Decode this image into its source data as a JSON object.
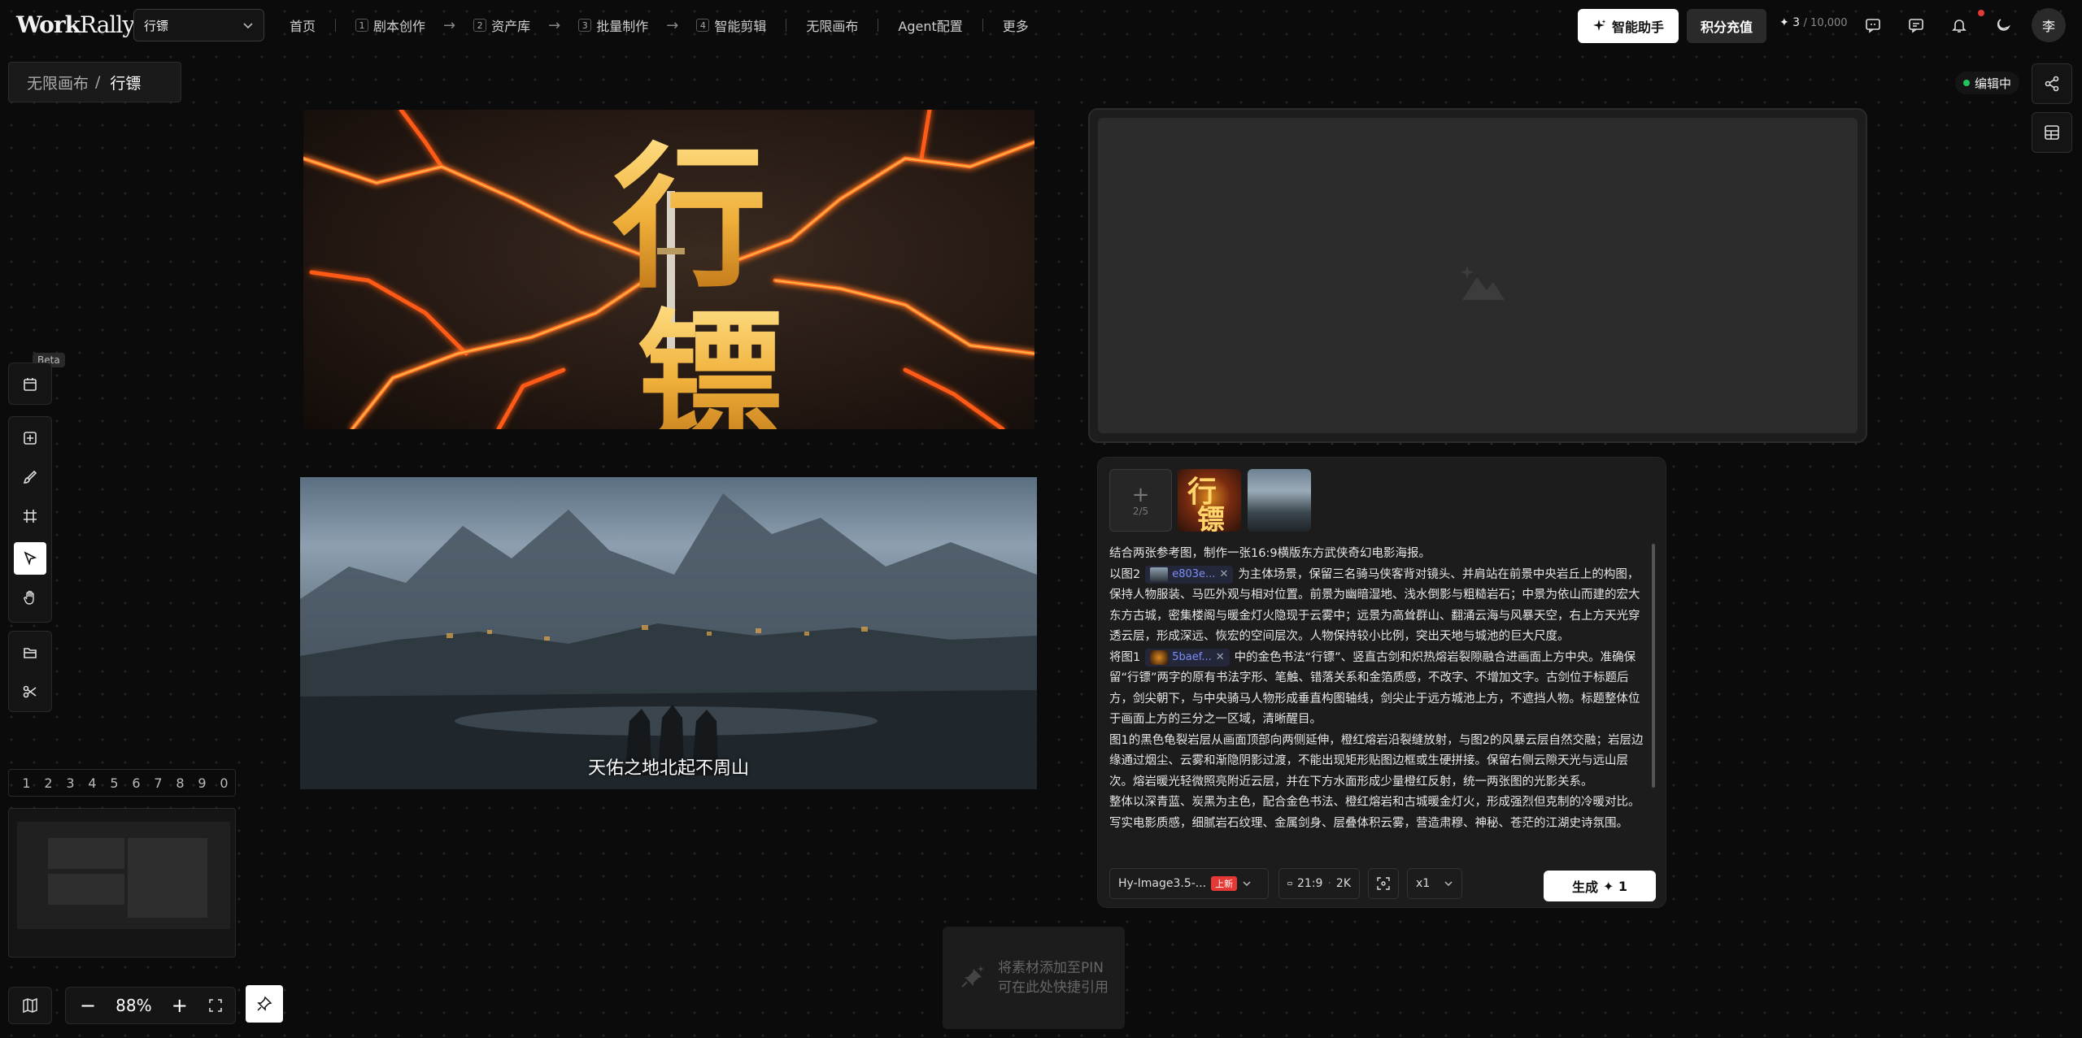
{
  "app": {
    "logo_part1": "Work",
    "logo_part2": "Rally"
  },
  "project_select": {
    "value": "行镖"
  },
  "nav": {
    "home": "首页",
    "steps": [
      {
        "num": "1",
        "label": "剧本创作"
      },
      {
        "num": "2",
        "label": "资产库"
      },
      {
        "num": "3",
        "label": "批量制作"
      },
      {
        "num": "4",
        "label": "智能剪辑"
      }
    ],
    "canvas": "无限画布",
    "agent": "Agent配置",
    "more": "更多"
  },
  "header": {
    "assistant_label": "智能助手",
    "recharge_label": "积分充值",
    "credits_used": "✦ 3",
    "credits_max": "/ 10,000",
    "avatar": "李"
  },
  "breadcrumb": {
    "parent": "无限画布",
    "sep": "/",
    "current": "行镖"
  },
  "edit_status": "编辑中",
  "beta_label": "Beta",
  "digits": [
    "1",
    "2",
    "3",
    "4",
    "5",
    "6",
    "7",
    "8",
    "9",
    "0"
  ],
  "zoom": {
    "minus": "−",
    "value": "88%",
    "plus": "+"
  },
  "poster1": {
    "title_chars": [
      "行",
      "镖"
    ]
  },
  "poster2": {
    "subtitle": "天佑之地北起不周山"
  },
  "panel": {
    "upload_count": "2/5",
    "chip1": "e803e...",
    "chip2": "5baef...",
    "prompt": {
      "line1": "结合两张参考图，制作一张16:9横版东方武侠奇幻电影海报。",
      "p2_before": "以图2",
      "p2_after": "为主体场景，保留三名骑马侠客背对镜头、并肩站在前景中央岩丘上的构图，保持人物服装、马匹外观与相对位置。前景为幽暗湿地、浅水倒影与粗糙岩石；中景为依山而建的宏大东方古城，密集楼阁与暖金灯火隐现于云雾中；远景为高耸群山、翻涌云海与风暴天空，右上方天光穿透云层，形成深远、恢宏的空间层次。人物保持较小比例，突出天地与城池的巨大尺度。",
      "p3_before": "将图1",
      "p3_after": "中的金色书法“行镖”、竖直古剑和炽热熔岩裂隙融合进画面上方中央。准确保留“行镖”两字的原有书法字形、笔触、错落关系和金箔质感，不改字、不增加文字。古剑位于标题后方，剑尖朝下，与中央骑马人物形成垂直构图轴线，剑尖止于远方城池上方，不遮挡人物。标题整体位于画面上方的三分之一区域，清晰醒目。",
      "p4": "图1的黑色龟裂岩层从画面顶部向两侧延伸，橙红熔岩沿裂缝放射，与图2的风暴云层自然交融；岩层边缘通过烟尘、云雾和渐隐阴影过渡，不能出现矩形贴图边框或生硬拼接。保留右侧云隙天光与远山层次。熔岩暖光轻微照亮附近云层，并在下方水面形成少量橙红反射，统一两张图的光影关系。",
      "p5": "整体以深青蓝、炭黑为主色，配合金色书法、橙红熔岩和古城暖金灯火，形成强烈但克制的冷暖对比。写实电影质感，细腻岩石纹理、金属剑身、层叠体积云雾，营造肃穆、神秘、苍茫的江湖史诗氛围。"
    },
    "model": "Hy-Image3.5-...",
    "model_badge": "上新",
    "ratio": "21:9",
    "resolution": "2K",
    "count": "x1",
    "generate_label": "生成",
    "generate_cost": "✦ 1"
  },
  "pin_drop": {
    "line1": "将素材添加至PIN",
    "line2": "可在此处快捷引用"
  }
}
